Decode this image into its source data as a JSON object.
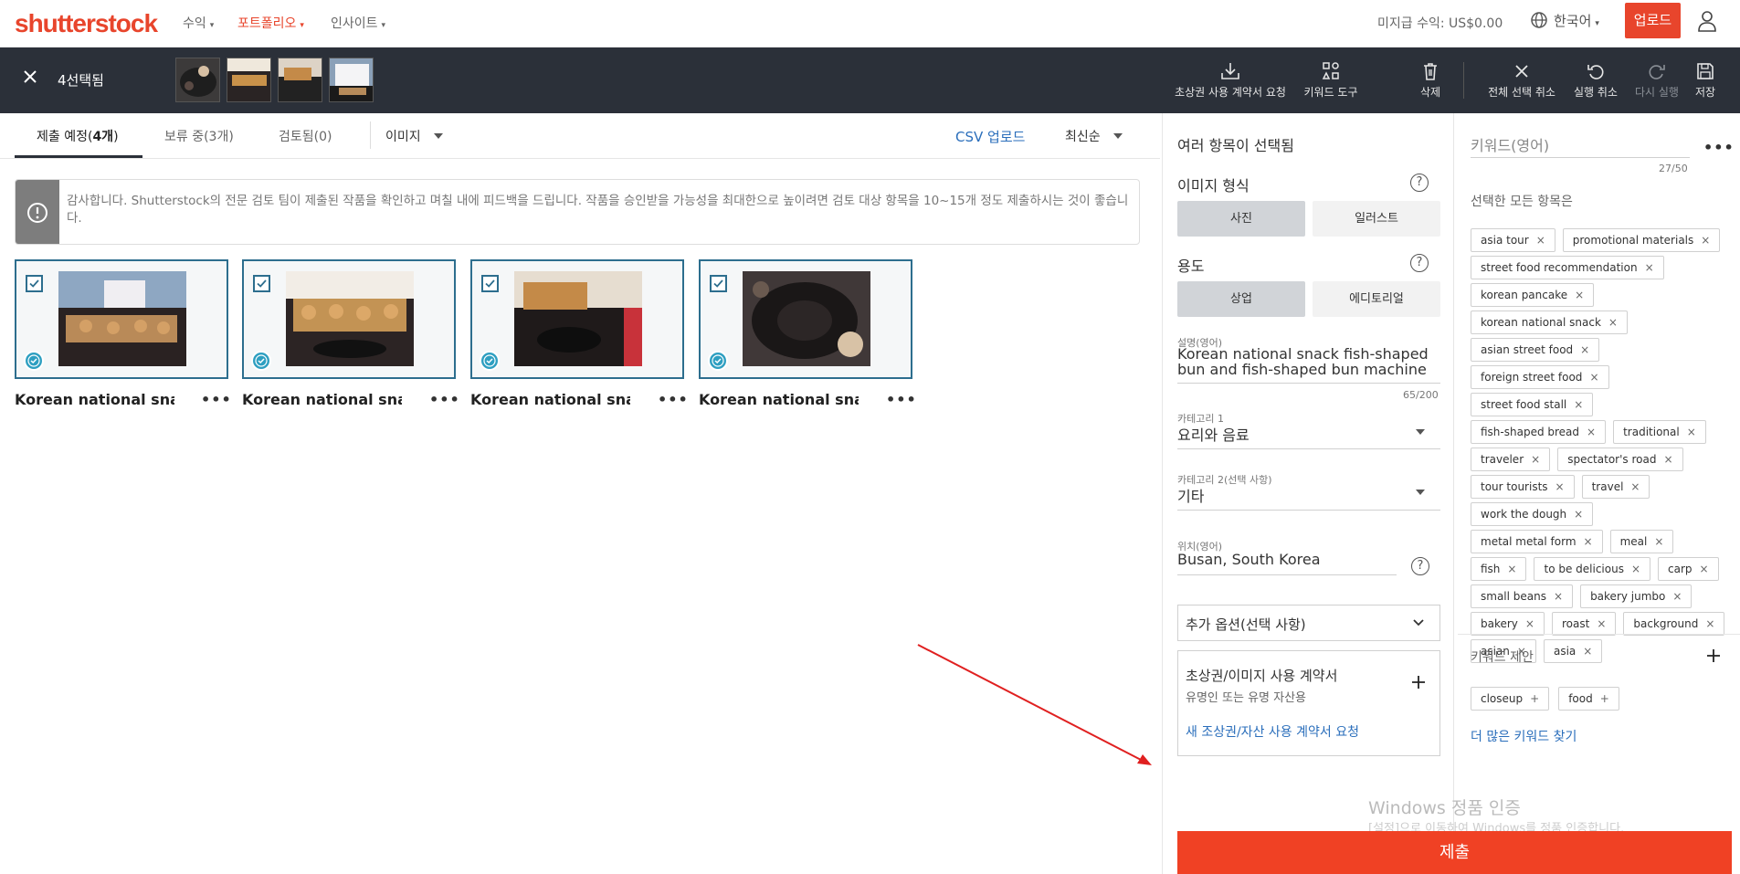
{
  "nav": {
    "logo": "shutterstock",
    "items": [
      "수익",
      "포트폴리오",
      "인사이트"
    ],
    "earnings": "미지급 수익: US$0.00",
    "language": "한국어",
    "upload": "업로드"
  },
  "selection_bar": {
    "count_label": "4선택됨",
    "tools": {
      "release_request": "초상권 사용 계약서 요청",
      "keyword_tool": "키워드 도구",
      "delete": "삭제",
      "deselect_all": "전체 선택 취소",
      "undo": "실행 취소",
      "redo": "다시 실행",
      "save": "저장"
    }
  },
  "tabs": {
    "to_submit_prefix": "제출 예정(",
    "to_submit_count": "4개",
    "to_submit_suffix": ")",
    "pending": "보류 중(3개)",
    "reviewed": "검토됨(0)",
    "media_type": "이미지",
    "csv_upload": "CSV 업로드",
    "sort": "최신순"
  },
  "info_banner": "감사합니다. Shutterstock의 전문 검토 팀이 제출된 작품을 확인하고 며칠 내에 피드백을 드립니다. 작품을 승인받을 가능성을 최대한으로 높이려면 검토 대상 항목을 10~15개 정도 제출하시는 것이 좋습니다.",
  "cards": [
    {
      "title": "Korean national sna..."
    },
    {
      "title": "Korean national sna..."
    },
    {
      "title": "Korean national sna..."
    },
    {
      "title": "Korean national sna..."
    }
  ],
  "card_more": "•••",
  "details": {
    "header": "여러 항목이 선택됨",
    "image_type_label": "이미지 형식",
    "image_type_photo": "사진",
    "image_type_illustration": "일러스트",
    "usage_label": "용도",
    "usage_commercial": "상업",
    "usage_editorial": "에디토리얼",
    "description_label": "설명(영어)",
    "description_value": "Korean national snack fish-shaped bun and fish-shaped bun machine",
    "description_counter": "65/200",
    "category1_label": "카테고리 1",
    "category1_value": "요리와 음료",
    "category2_label": "카테고리 2(선택 사항)",
    "category2_value": "기타",
    "location_label": "위치(영어)",
    "location_value": "Busan, South Korea",
    "extra_options": "추가 옵션(선택 사항)",
    "release_title": "초상권/이미지 사용 계약서",
    "release_subtitle": "유명인 또는 유명 자산용",
    "release_link": "새 조상권/자산 사용 계약서 요청",
    "submit": "제출"
  },
  "keywords": {
    "placeholder": "키워드(영어)",
    "counter": "27/50",
    "all_selected_label": "선택한 모든 항목은",
    "list": [
      "asia tour",
      "promotional materials",
      "street food recommendation",
      "korean pancake",
      "korean national snack",
      "asian street food",
      "foreign street food",
      "street food stall",
      "fish-shaped bread",
      "traditional",
      "traveler",
      "spectator's road",
      "tour tourists",
      "travel",
      "work the dough",
      "metal metal form",
      "meal",
      "fish",
      "to be delicious",
      "carp",
      "small beans",
      "bakery jumbo",
      "bakery",
      "roast",
      "background",
      "asian",
      "asia"
    ],
    "suggest_label": "키워드 제안",
    "suggestions": [
      "closeup",
      "food"
    ],
    "more_link": "더 많은 키워드 찾기"
  },
  "watermark": {
    "title": "Windows 정품 인증",
    "subtitle": "[설정]으로 이동하여 Windows를 정품 인증합니다."
  },
  "colors": {
    "brand": "#e8452c",
    "dark_bar": "#2b3039",
    "accent_blue": "#2d6e8e",
    "submit": "#f04124"
  }
}
